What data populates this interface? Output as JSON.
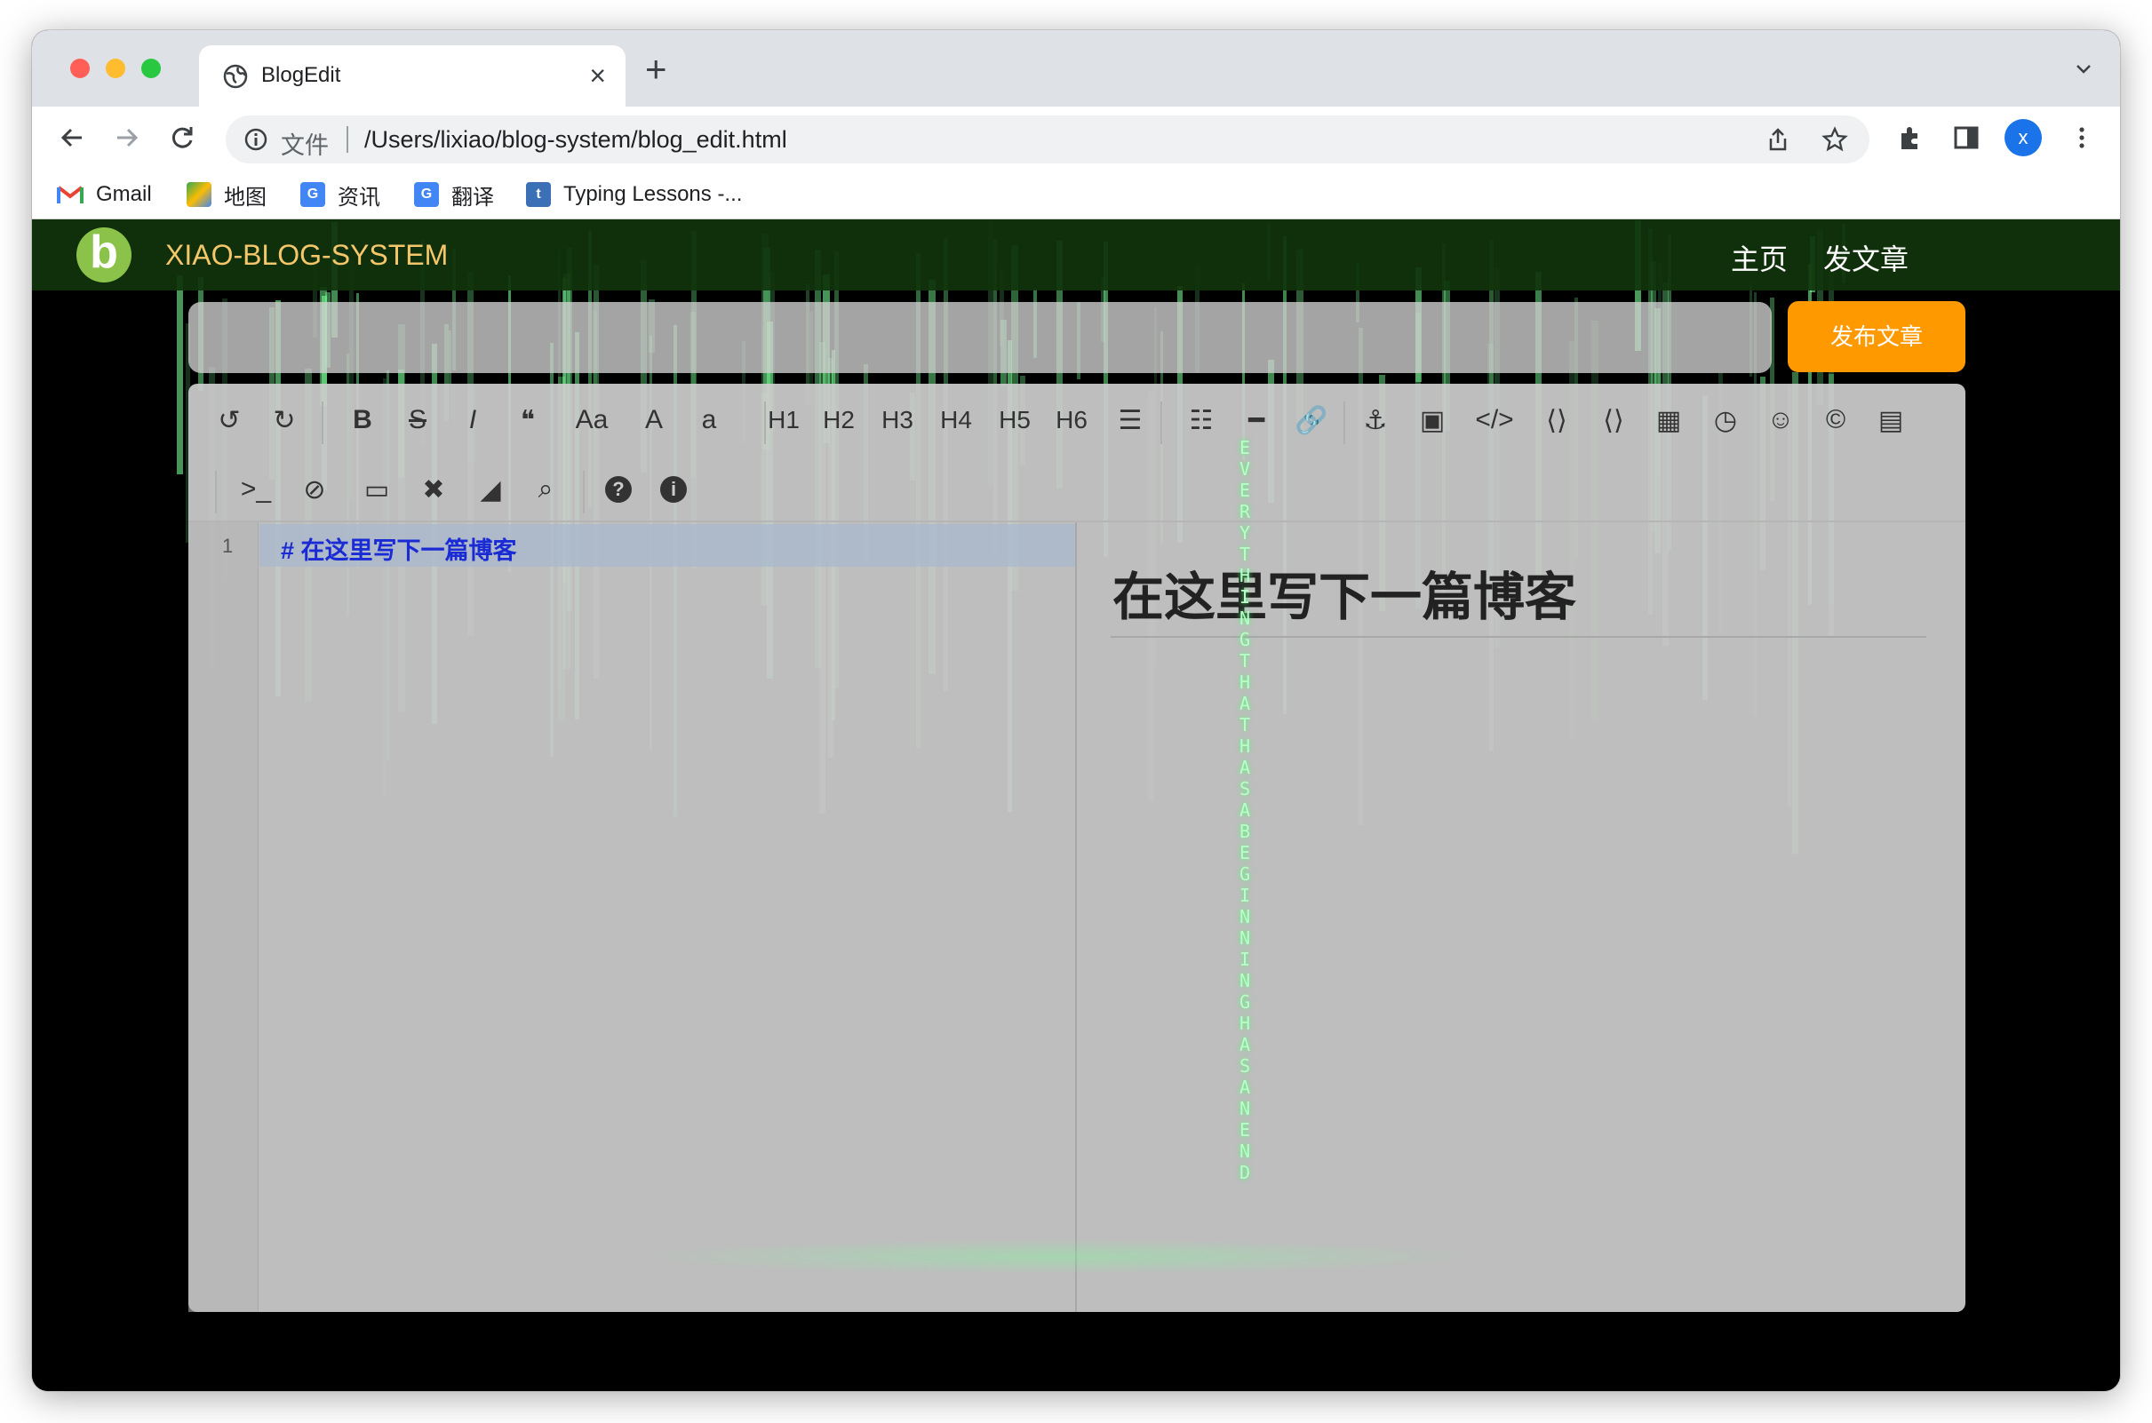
{
  "browser": {
    "tab_title": "BlogEdit",
    "new_tab_label": "+",
    "close_label": "×",
    "url_scheme_label": "文件",
    "url": "/Users/lixiao/blog-system/blog_edit.html",
    "profile_initial": "x",
    "bookmarks": [
      {
        "label": "Gmail",
        "icon": "gmail-icon"
      },
      {
        "label": "地图",
        "icon": "maps-icon"
      },
      {
        "label": "资讯",
        "icon": "news-icon"
      },
      {
        "label": "翻译",
        "icon": "translate-icon"
      },
      {
        "label": "Typing Lessons -...",
        "icon": "typing-icon"
      }
    ]
  },
  "site": {
    "logo_letter": "b",
    "brand": "XIAO-BLOG-SYSTEM",
    "nav": {
      "home": "主页",
      "post": "发文章"
    },
    "publish_label": "发布文章",
    "title_placeholder": ""
  },
  "editor": {
    "toolbar_row1": [
      {
        "name": "undo-icon",
        "glyph": "↺"
      },
      {
        "name": "redo-icon",
        "glyph": "↻"
      },
      {
        "name": "bold-icon",
        "glyph": "B"
      },
      {
        "name": "strikethrough-icon",
        "glyph": "S"
      },
      {
        "name": "italic-icon",
        "glyph": "I"
      },
      {
        "name": "quote-icon",
        "glyph": "❝"
      },
      {
        "name": "uppercase-icon",
        "glyph": "Aa"
      },
      {
        "name": "uppercase-all-icon",
        "glyph": "A"
      },
      {
        "name": "lowercase-icon",
        "glyph": "a"
      },
      {
        "name": "h1-button",
        "glyph": "H1"
      },
      {
        "name": "h2-button",
        "glyph": "H2"
      },
      {
        "name": "h3-button",
        "glyph": "H3"
      },
      {
        "name": "h4-button",
        "glyph": "H4"
      },
      {
        "name": "h5-button",
        "glyph": "H5"
      },
      {
        "name": "h6-button",
        "glyph": "H6"
      },
      {
        "name": "unordered-list-icon",
        "glyph": "☰"
      },
      {
        "name": "ordered-list-icon",
        "glyph": "☷"
      },
      {
        "name": "horizontal-rule-icon",
        "glyph": "━"
      },
      {
        "name": "link-icon",
        "glyph": "🔗"
      },
      {
        "name": "anchor-icon",
        "glyph": "⚓"
      },
      {
        "name": "image-icon",
        "glyph": "▣"
      },
      {
        "name": "code-icon",
        "glyph": "</>"
      },
      {
        "name": "code-block-icon",
        "glyph": "⟨⟩"
      },
      {
        "name": "preformatted-icon",
        "glyph": "⟨⟩"
      },
      {
        "name": "table-icon",
        "glyph": "▦"
      },
      {
        "name": "datetime-icon",
        "glyph": "◷"
      },
      {
        "name": "emoji-icon",
        "glyph": "☺"
      },
      {
        "name": "html-entities-icon",
        "glyph": "©"
      },
      {
        "name": "pagebreak-icon",
        "glyph": "▤"
      }
    ],
    "toolbar_row2": [
      {
        "name": "goto-line-icon",
        "glyph": ">_"
      },
      {
        "name": "watch-toggle-icon",
        "glyph": "⊘"
      },
      {
        "name": "preview-icon",
        "glyph": "▭"
      },
      {
        "name": "fullscreen-icon",
        "glyph": "✖"
      },
      {
        "name": "clear-icon",
        "glyph": "◢"
      },
      {
        "name": "search-icon",
        "glyph": "⌕"
      },
      {
        "name": "help-icon",
        "glyph": "?"
      },
      {
        "name": "info-icon",
        "glyph": "i"
      }
    ],
    "line_number": "1",
    "code_line": "# 在这里写下一篇博客",
    "preview_heading": "在这里写下一篇博客"
  },
  "background_text": "EVERYTHING THAT HAS A BEGINNING HAS AN END"
}
